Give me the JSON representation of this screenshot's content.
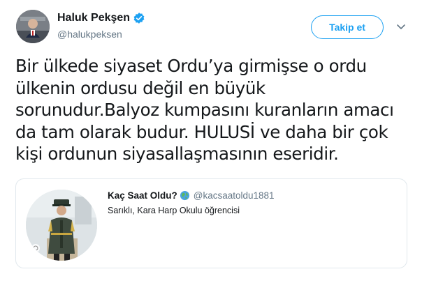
{
  "author": {
    "display_name": "Haluk Pekşen",
    "handle": "@halukpeksen",
    "verified": true,
    "avatar_icon": "profile-photo"
  },
  "actions": {
    "follow_label": "Takip et",
    "more_icon": "chevron-down-icon"
  },
  "tweet": {
    "text": "Bir ülkede siyaset Ordu’ya girmişse o ordu\nülkenin ordusu değil en büyük\nsorunudur.Balyoz kumpasını kuranların amacı\nda tam olarak budur. HULUSİ ve daha bir çok\nkişi ordunun siyasallaşmasının eseridir."
  },
  "quoted_tweet": {
    "display_name": "Kaç Saat Oldu?",
    "emoji_icon": "globe-icon",
    "handle": "@kacsaatoldu1881",
    "text": "Sarıklı, Kara Harp Okulu öğrencisi",
    "thumbnail_icon": "cadet-photo"
  },
  "colors": {
    "accent": "#1da1f2",
    "text_primary": "#14171a",
    "text_secondary": "#657786",
    "border": "#e1e8ed"
  }
}
